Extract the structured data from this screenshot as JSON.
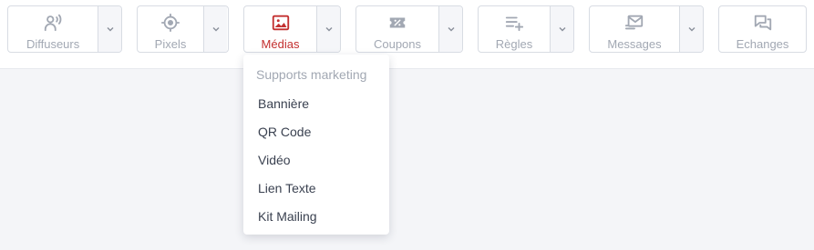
{
  "toolbar": {
    "buttons": [
      {
        "label": "Diffuseurs",
        "icon": "broadcaster-icon",
        "has_dropdown": true
      },
      {
        "label": "Pixels",
        "icon": "crosshair-icon",
        "has_dropdown": true
      },
      {
        "label": "Médias",
        "icon": "image-icon",
        "has_dropdown": true,
        "active": true
      },
      {
        "label": "Coupons",
        "icon": "ticket-icon",
        "has_dropdown": true
      },
      {
        "label": "Règles",
        "icon": "list-add-icon",
        "has_dropdown": true
      },
      {
        "label": "Messages",
        "icon": "mail-icon",
        "has_dropdown": true
      },
      {
        "label": "Echanges",
        "icon": "chat-icon",
        "has_dropdown": false
      }
    ]
  },
  "media_menu": {
    "header": "Supports marketing",
    "items": [
      "Bannière",
      "QR Code",
      "Vidéo",
      "Lien Texte",
      "Kit Mailing"
    ]
  },
  "colors": {
    "active": "#c33030",
    "inactive": "#a2a8b3",
    "border": "#d8dce3",
    "page_bg": "#f4f5f8"
  }
}
